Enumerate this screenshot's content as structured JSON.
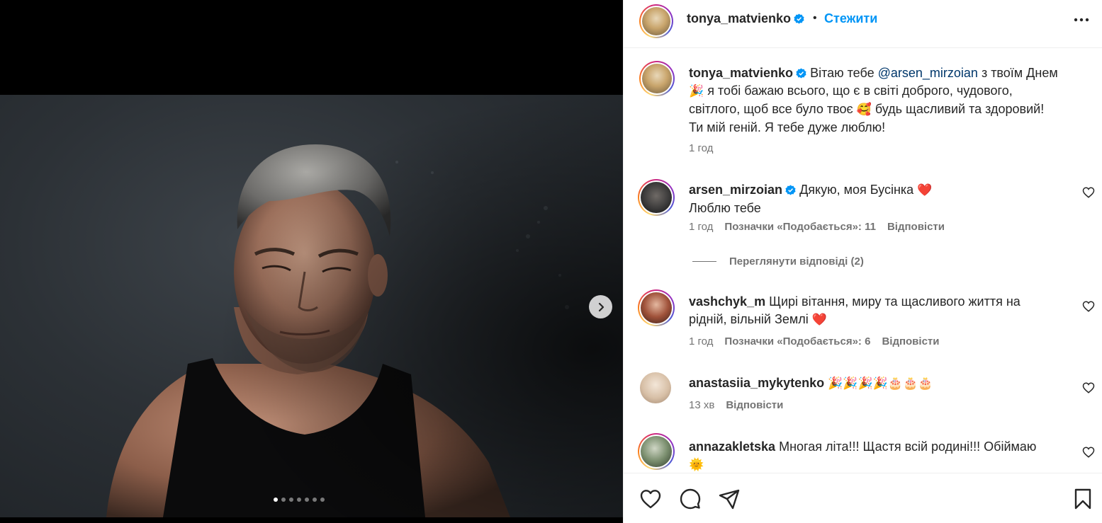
{
  "post": {
    "author": "tonya_matvienko",
    "follow_label": "Стежити",
    "separator": "•",
    "carousel": {
      "total_slides": 7,
      "active_slide": 1
    }
  },
  "caption": {
    "user": "tonya_matvienko",
    "text_before": "Вітаю тебе ",
    "mention": "@arsen_mirzoian",
    "line1_after": " з твоїм Днем",
    "line2": "я тобі бажаю всього, що є в світі доброго, чудового,",
    "line3a": "світлого, щоб все було твоє ",
    "line3b": " будь щасливий та здоровий!",
    "line4": "Ти мій геній. Я тебе дуже люблю!",
    "emoji_party": "🎉",
    "emoji_smile": "🥰",
    "time": "1 год"
  },
  "comments": [
    {
      "user": "arsen_mirzoian",
      "text1": "Дякую, моя Бусінка ",
      "emoji": "❤️",
      "text2": "Люблю тебе",
      "time": "1 год",
      "likes": "Позначки «Подобається»: 11",
      "reply": "Відповісти",
      "view_replies": "Переглянути відповіді (2)"
    },
    {
      "user": "vashchyk_m",
      "text1": "Щирі вітання, миру та щасливого життя на",
      "text2": "рідній, вільній Землі ",
      "emoji": "❤️",
      "time": "1 год",
      "likes": "Позначки «Подобається»: 6",
      "reply": "Відповісти"
    },
    {
      "user": "anastasiia_mykytenko",
      "emojis": "🎉🎉🎉🎉🎂🎂🎂",
      "time": "13 хв",
      "reply": "Відповісти"
    },
    {
      "user": "annazakletska",
      "text1": "Многая літа!!! Щастя всій родині!!! Обіймаю",
      "emoji": "🌞"
    }
  ],
  "icons": {
    "more": "more-horizontal-icon",
    "like": "heart-icon",
    "comment": "comment-icon",
    "share": "send-icon",
    "save": "bookmark-icon",
    "next": "chevron-right-icon",
    "verified": "verified-badge-icon"
  },
  "colors": {
    "link": "#0095f6",
    "mention": "#00376b",
    "heart": "#ed1c24",
    "muted": "#737373"
  }
}
